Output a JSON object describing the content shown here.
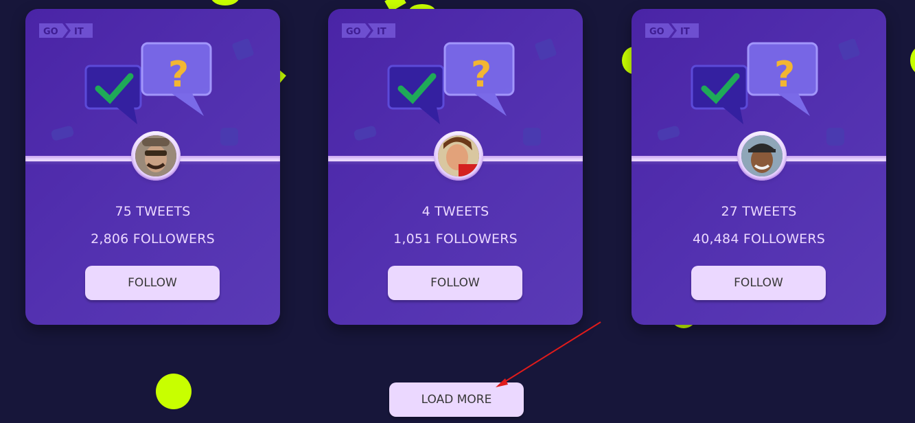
{
  "cards": [
    {
      "tweets": "75 TWEETS",
      "followers": "2,806 FOLLOWERS",
      "follow_label": "FOLLOW",
      "logo_go": "GO",
      "logo_it": "IT"
    },
    {
      "tweets": "4 TWEETS",
      "followers": "1,051 FOLLOWERS",
      "follow_label": "FOLLOW",
      "logo_go": "GO",
      "logo_it": "IT"
    },
    {
      "tweets": "27 TWEETS",
      "followers": "40,484 FOLLOWERS",
      "follow_label": "FOLLOW",
      "logo_go": "GO",
      "logo_it": "IT"
    }
  ],
  "load_more_label": "LOAD MORE",
  "colors": {
    "background": "#17163a",
    "card": "#5736a3",
    "button": "#ebd8ff",
    "accent_dots": "#c8ff00",
    "annotation_arrow": "#e01b1b"
  },
  "icons": [
    "goit-logo",
    "checkmark-bubble-icon",
    "question-bubble-icon",
    "avatar"
  ]
}
